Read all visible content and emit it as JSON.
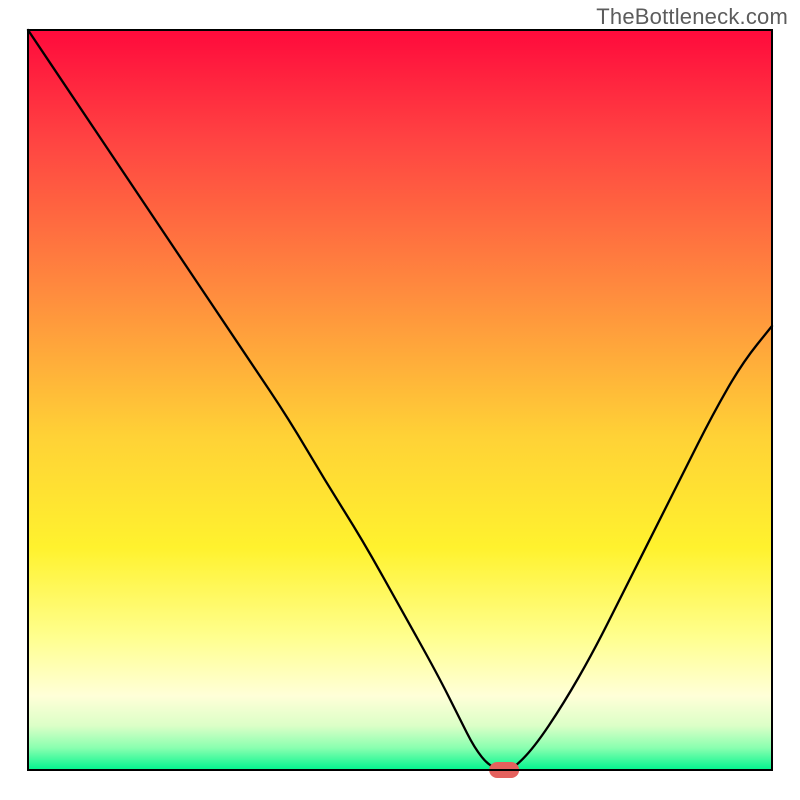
{
  "watermark": "TheBottleneck.com",
  "chart_data": {
    "type": "line",
    "title": "",
    "xlabel": "",
    "ylabel": "",
    "xlim": [
      0,
      100
    ],
    "ylim": [
      0,
      100
    ],
    "grid": false,
    "legend": false,
    "background_gradient": {
      "orientation": "vertical",
      "stops": [
        {
          "offset": 0.0,
          "color": "#ff0a3c"
        },
        {
          "offset": 0.15,
          "color": "#ff4442"
        },
        {
          "offset": 0.35,
          "color": "#ff8a3e"
        },
        {
          "offset": 0.55,
          "color": "#ffd236"
        },
        {
          "offset": 0.7,
          "color": "#fff22e"
        },
        {
          "offset": 0.82,
          "color": "#ffff8e"
        },
        {
          "offset": 0.9,
          "color": "#ffffd8"
        },
        {
          "offset": 0.94,
          "color": "#dcffc7"
        },
        {
          "offset": 0.97,
          "color": "#8affb0"
        },
        {
          "offset": 1.0,
          "color": "#00f58e"
        }
      ]
    },
    "series": [
      {
        "name": "bottleneck-curve",
        "x": [
          0,
          6,
          12,
          18,
          24,
          26,
          30,
          35,
          40,
          45,
          50,
          55,
          58,
          60,
          62,
          64,
          65,
          68,
          72,
          76,
          80,
          84,
          88,
          92,
          96,
          100
        ],
        "y": [
          100,
          91,
          82,
          73,
          64,
          61,
          55,
          47.5,
          39,
          31,
          22,
          13,
          7,
          3,
          0.5,
          0,
          0,
          3,
          9,
          16,
          24,
          32,
          40,
          48,
          55,
          60
        ]
      }
    ],
    "marker": {
      "name": "optimal-point",
      "x": 64,
      "y": 0,
      "color": "#e4615d",
      "shape": "capsule"
    }
  }
}
